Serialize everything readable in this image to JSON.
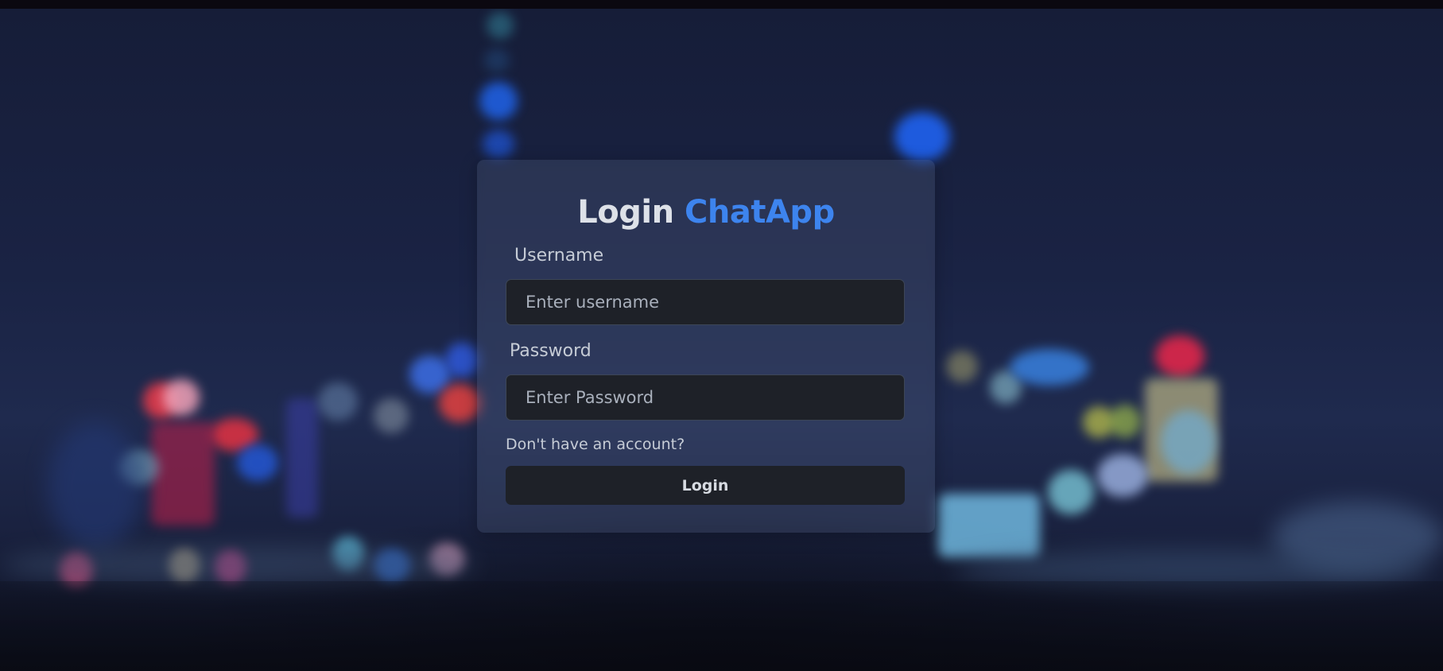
{
  "colors": {
    "accent": "#3d84ee",
    "card_background": "rgba(120,140,170,0.18)",
    "input_background": "#1e2128",
    "page_background": "#141a33"
  },
  "background": {
    "image": "blurred-night-city-skyline"
  },
  "login": {
    "title_prefix": "Login",
    "title_brand": "ChatApp",
    "username_label": "Username",
    "username_placeholder": "Enter username",
    "username_value": "",
    "password_label": "Password",
    "password_placeholder": "Enter Password",
    "password_value": "",
    "signup_link": "Don't have an account?",
    "submit_label": "Login"
  }
}
